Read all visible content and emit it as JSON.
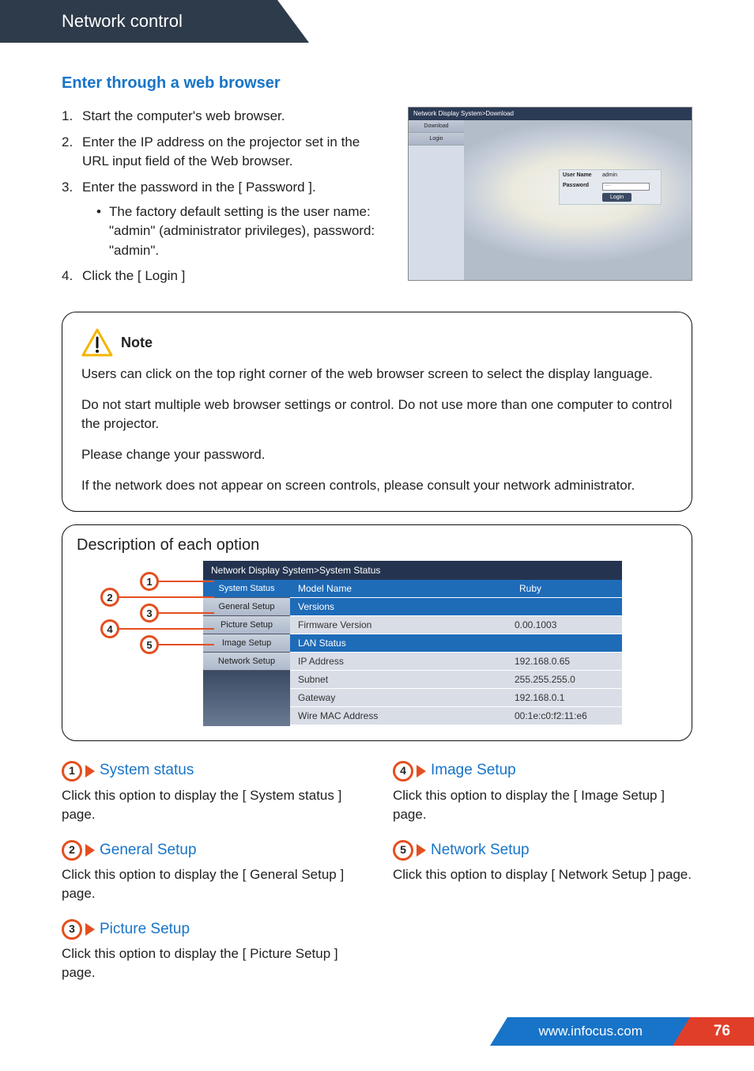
{
  "header": {
    "title": "Network control"
  },
  "section": {
    "title": "Enter through a web browser",
    "steps": {
      "s1": "Start the computer's web browser.",
      "s2": "Enter the IP address on the projector set in the URL input field of the Web browser.",
      "s3": "Enter the password in the [ Password ].",
      "s3sub": "The factory default setting is the user name: \"admin\" (administrator privileges), password: \"admin\".",
      "s4": "Click the [ Login ]"
    }
  },
  "login_screenshot": {
    "titlebar": "Network Display System>Download",
    "side": {
      "download": "Download",
      "login": "Login"
    },
    "form": {
      "username_label": "User Name",
      "username_value": "admin",
      "password_label": "Password",
      "password_value": "····",
      "login_btn": "Login"
    }
  },
  "note": {
    "heading": "Note",
    "p1": "Users can click on the top right corner of the web browser screen to select the display language.",
    "p2": "Do not start multiple web browser settings or control. Do not use more than one computer to control the projector.",
    "p3": "Please change your password.",
    "p4": "If the network does not appear on screen controls, please consult your network administrator."
  },
  "description": {
    "title": "Description of each option",
    "breadcrumb": "Network Display System>System Status",
    "sidebar": {
      "i1": "System Status",
      "i2": "General Setup",
      "i3": "Picture Setup",
      "i4": "Image Setup",
      "i5": "Network Setup"
    },
    "sections": {
      "model_head": "Model Name",
      "model_val": "Ruby",
      "versions_head": "Versions",
      "fw_k": "Firmware Version",
      "fw_v": "0.00.1003",
      "lan_head": "LAN Status",
      "ip_k": "IP Address",
      "ip_v": "192.168.0.65",
      "sn_k": "Subnet",
      "sn_v": "255.255.255.0",
      "gw_k": "Gateway",
      "gw_v": "192.168.0.1",
      "mac_k": "Wire MAC Address",
      "mac_v": "00:1e:c0:f2:11:e6"
    }
  },
  "options": {
    "o1": {
      "title": "System status",
      "body": "Click this option to display the [ System status ] page."
    },
    "o2": {
      "title": "General Setup",
      "body": "Click this option to display the [ General Setup ] page."
    },
    "o3": {
      "title": "Picture Setup",
      "body": "Click this option to display the [ Picture Setup ] page."
    },
    "o4": {
      "title": "Image Setup",
      "body": "Click this option to display the [ Image Setup ] page."
    },
    "o5": {
      "title": "Network Setup",
      "body": "Click this option to display [ Network Setup ] page."
    }
  },
  "footer": {
    "url": "www.infocus.com",
    "page": "76"
  },
  "chart_data": {
    "type": "table",
    "title": "Network Display System > System Status",
    "rows": [
      {
        "section": "Model Name",
        "key": "Model Name",
        "value": "Ruby"
      },
      {
        "section": "Versions",
        "key": "Firmware Version",
        "value": "0.00.1003"
      },
      {
        "section": "LAN Status",
        "key": "IP Address",
        "value": "192.168.0.65"
      },
      {
        "section": "LAN Status",
        "key": "Subnet",
        "value": "255.255.255.0"
      },
      {
        "section": "LAN Status",
        "key": "Gateway",
        "value": "192.168.0.1"
      },
      {
        "section": "LAN Status",
        "key": "Wire MAC Address",
        "value": "00:1e:c0:f2:11:e6"
      }
    ]
  }
}
